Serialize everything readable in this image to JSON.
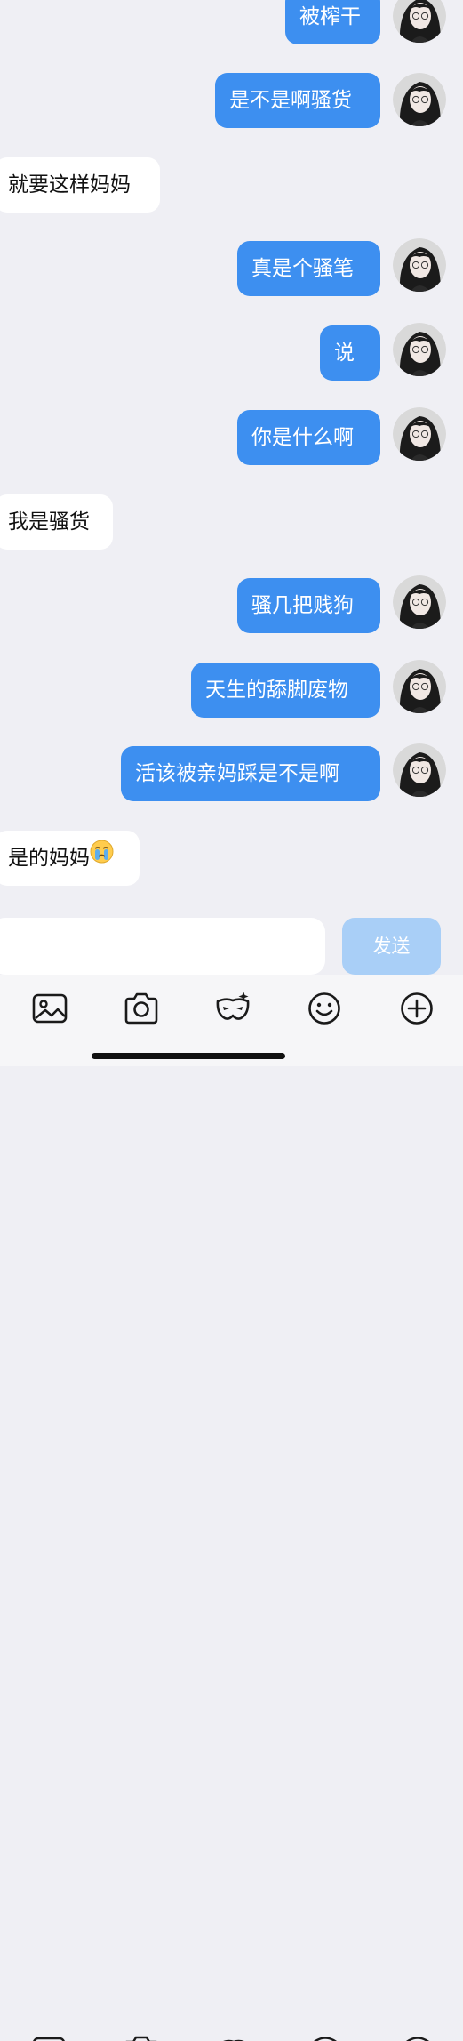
{
  "messages": [
    {
      "side": "me",
      "text": "被榨干"
    },
    {
      "side": "me",
      "text": "是不是啊骚货"
    },
    {
      "side": "them",
      "text": "就要这样妈妈"
    },
    {
      "side": "me",
      "text": "真是个骚笔"
    },
    {
      "side": "me",
      "text": "说"
    },
    {
      "side": "me",
      "text": "你是什么啊"
    },
    {
      "side": "them",
      "text": "我是骚货"
    },
    {
      "side": "me",
      "text": "骚几把贱狗"
    },
    {
      "side": "me",
      "text": "天生的舔脚废物"
    },
    {
      "side": "me",
      "text": "活该被亲妈踩是不是啊"
    },
    {
      "side": "them",
      "text": "是的妈妈",
      "emoji": "crying-face-emoji"
    }
  ],
  "composer": {
    "input_value": "",
    "send_label": "发送"
  },
  "toolbar": {
    "icons": [
      "image-icon",
      "camera-icon",
      "mask-icon",
      "smiley-icon",
      "plus-circle-icon"
    ]
  },
  "colors": {
    "background": "#efeff4",
    "my_bubble": "#3d8ff0",
    "their_bubble": "#ffffff",
    "send_disabled": "#a9cff7"
  }
}
